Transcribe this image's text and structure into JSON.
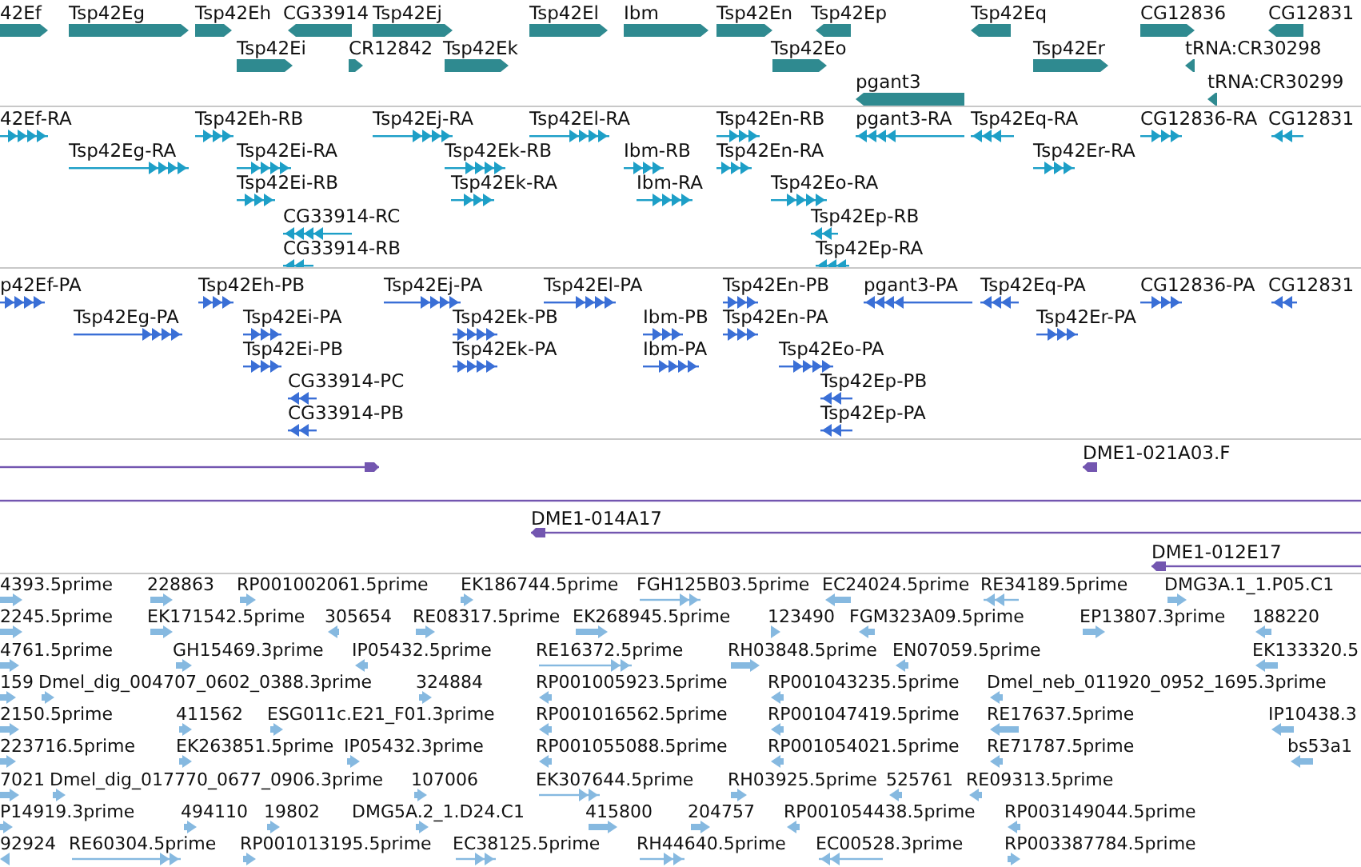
{
  "tracks": [
    {
      "kind": "gene",
      "features": [
        {
          "label": "42Ef",
          "reverse": false
        },
        {
          "label": "Tsp42Eg",
          "reverse": false
        },
        {
          "label": "Tsp42Eh",
          "reverse": false
        },
        {
          "label": "CG33914",
          "reverse": true
        },
        {
          "label": "Tsp42Ej",
          "reverse": false
        },
        {
          "label": "Tsp42El",
          "reverse": false
        },
        {
          "label": "Ibm",
          "reverse": false
        },
        {
          "label": "Tsp42En",
          "reverse": false
        },
        {
          "label": "Tsp42Ep",
          "reverse": true
        },
        {
          "label": "Tsp42Eq",
          "reverse": true
        },
        {
          "label": "CG12836",
          "reverse": false
        },
        {
          "label": "CG12831",
          "reverse": true
        },
        {
          "label": "Tsp42Ei",
          "reverse": false
        },
        {
          "label": "CR12842",
          "reverse": false
        },
        {
          "label": "Tsp42Ek",
          "reverse": false
        },
        {
          "label": "Tsp42Eo",
          "reverse": false
        },
        {
          "label": "Tsp42Er",
          "reverse": false
        },
        {
          "label": "tRNA:CR30298",
          "reverse": true
        },
        {
          "label": "pgant3",
          "reverse": true
        },
        {
          "label": "tRNA:CR30299",
          "reverse": true
        }
      ]
    },
    {
      "kind": "transcript",
      "features": [
        {
          "label": "42Ef-RA",
          "reverse": false
        },
        {
          "label": "Tsp42Eh-RB",
          "reverse": false
        },
        {
          "label": "Tsp42Ej-RA",
          "reverse": false
        },
        {
          "label": "Tsp42El-RA",
          "reverse": false
        },
        {
          "label": "Tsp42En-RB",
          "reverse": false
        },
        {
          "label": "pgant3-RA",
          "reverse": true
        },
        {
          "label": "Tsp42Eq-RA",
          "reverse": true
        },
        {
          "label": "CG12836-RA",
          "reverse": false
        },
        {
          "label": "CG12831",
          "reverse": true
        },
        {
          "label": "Tsp42Eg-RA",
          "reverse": false
        },
        {
          "label": "Tsp42Ei-RA",
          "reverse": false
        },
        {
          "label": "Tsp42Ek-RB",
          "reverse": false
        },
        {
          "label": "Ibm-RB",
          "reverse": false
        },
        {
          "label": "Tsp42En-RA",
          "reverse": false
        },
        {
          "label": "Tsp42Er-RA",
          "reverse": false
        },
        {
          "label": "Tsp42Ei-RB",
          "reverse": false
        },
        {
          "label": "Tsp42Ek-RA",
          "reverse": false
        },
        {
          "label": "Ibm-RA",
          "reverse": false
        },
        {
          "label": "Tsp42Eo-RA",
          "reverse": false
        },
        {
          "label": "CG33914-RC",
          "reverse": true
        },
        {
          "label": "Tsp42Ep-RB",
          "reverse": true
        },
        {
          "label": "CG33914-RB",
          "reverse": true
        },
        {
          "label": "Tsp42Ep-RA",
          "reverse": true
        }
      ]
    },
    {
      "kind": "protein",
      "features": [
        {
          "label": "p42Ef-PA",
          "reverse": false
        },
        {
          "label": "Tsp42Eh-PB",
          "reverse": false
        },
        {
          "label": "Tsp42Ej-PA",
          "reverse": false
        },
        {
          "label": "Tsp42El-PA",
          "reverse": false
        },
        {
          "label": "Tsp42En-PB",
          "reverse": false
        },
        {
          "label": "pgant3-PA",
          "reverse": true
        },
        {
          "label": "Tsp42Eq-PA",
          "reverse": true
        },
        {
          "label": "CG12836-PA",
          "reverse": false
        },
        {
          "label": "CG12831",
          "reverse": true
        },
        {
          "label": "Tsp42Eg-PA",
          "reverse": false
        },
        {
          "label": "Tsp42Ei-PA",
          "reverse": false
        },
        {
          "label": "Tsp42Ek-PB",
          "reverse": false
        },
        {
          "label": "Ibm-PB",
          "reverse": false
        },
        {
          "label": "Tsp42En-PA",
          "reverse": false
        },
        {
          "label": "Tsp42Er-PA",
          "reverse": false
        },
        {
          "label": "Tsp42Ei-PB",
          "reverse": false
        },
        {
          "label": "Tsp42Ek-PA",
          "reverse": false
        },
        {
          "label": "Ibm-PA",
          "reverse": false
        },
        {
          "label": "Tsp42Eo-PA",
          "reverse": false
        },
        {
          "label": "CG33914-PC",
          "reverse": true
        },
        {
          "label": "Tsp42Ep-PB",
          "reverse": true
        },
        {
          "label": "CG33914-PB",
          "reverse": true
        },
        {
          "label": "Tsp42Ep-PA",
          "reverse": true
        }
      ]
    },
    {
      "kind": "clone",
      "features": [
        {
          "kind": "arrow",
          "reverse": false
        },
        {
          "kind": "arrow",
          "label": "DME1-021A03.F",
          "reverse": true
        },
        {
          "kind": "span"
        },
        {
          "kind": "arrow",
          "label": "DME1-014A17",
          "reverse": true
        },
        {
          "kind": "arrow",
          "label": "DME1-012E17",
          "reverse": true
        }
      ]
    },
    {
      "kind": "est",
      "features": [
        {
          "label": "4393.5prime",
          "reverse": false
        },
        {
          "label": "228863",
          "reverse": false
        },
        {
          "label": "RP001002061.5prime",
          "reverse": false
        },
        {
          "label": "EK186744.5prime",
          "reverse": false
        },
        {
          "label": "FGH125B03.5prime",
          "reverse": false
        },
        {
          "label": "EC24024.5prime",
          "reverse": true
        },
        {
          "label": "RE34189.5prime",
          "reverse": true
        },
        {
          "label": "DMG3A.1_1.P05.C1",
          "reverse": false
        },
        {
          "label": "2245.5prime",
          "reverse": false
        },
        {
          "label": "EK171542.5prime",
          "reverse": false
        },
        {
          "label": "305654",
          "reverse": true
        },
        {
          "label": "RE08317.5prime",
          "reverse": false
        },
        {
          "label": "EK268945.5prime",
          "reverse": false
        },
        {
          "label": "123490",
          "reverse": false
        },
        {
          "label": "FGM323A09.5prime",
          "reverse": true
        },
        {
          "label": "EP13807.3prime",
          "reverse": false
        },
        {
          "label": "188220",
          "reverse": true
        },
        {
          "label": "4761.5prime",
          "reverse": false
        },
        {
          "label": "GH15469.3prime",
          "reverse": false
        },
        {
          "label": "IP05432.5prime",
          "reverse": true
        },
        {
          "label": "RE16372.5prime",
          "reverse": false
        },
        {
          "label": "RH03848.5prime",
          "reverse": false
        },
        {
          "label": "EN07059.5prime",
          "reverse": true
        },
        {
          "label": "EK133320.5",
          "reverse": true
        },
        {
          "label": "159",
          "reverse": false
        },
        {
          "label": "Dmel_dig_004707_0602_0388.3prime",
          "reverse": false
        },
        {
          "label": "324884",
          "reverse": false
        },
        {
          "label": "RP001005923.5prime",
          "reverse": true
        },
        {
          "label": "RP001043235.5prime",
          "reverse": true
        },
        {
          "label": "Dmel_neb_011920_0952_1695.3prime",
          "reverse": true
        },
        {
          "label": "2150.5prime",
          "reverse": false
        },
        {
          "label": "411562",
          "reverse": false
        },
        {
          "label": "ESG011c.E21_F01.3prime",
          "reverse": false
        },
        {
          "label": "RP001016562.5prime",
          "reverse": true
        },
        {
          "label": "RP001047419.5prime",
          "reverse": true
        },
        {
          "label": "RE17637.5prime",
          "reverse": true
        },
        {
          "label": "IP10438.3",
          "reverse": true
        },
        {
          "label": "223716.5prime",
          "reverse": false
        },
        {
          "label": "EK263851.5prime",
          "reverse": false
        },
        {
          "label": "IP05432.3prime",
          "reverse": false
        },
        {
          "label": "RP001055088.5prime",
          "reverse": true
        },
        {
          "label": "RP001054021.5prime",
          "reverse": true
        },
        {
          "label": "RE71787.5prime",
          "reverse": true
        },
        {
          "label": "bs53a1",
          "reverse": true
        },
        {
          "label": "7021",
          "reverse": false
        },
        {
          "label": "Dmel_dig_017770_0677_0906.3prime",
          "reverse": false
        },
        {
          "label": "107006",
          "reverse": false
        },
        {
          "label": "EK307644.5prime",
          "reverse": false
        },
        {
          "label": "RH03925.5prime",
          "reverse": false
        },
        {
          "label": "525761",
          "reverse": true
        },
        {
          "label": "RE09313.5prime",
          "reverse": true
        },
        {
          "label": "P14919.3prime",
          "reverse": false
        },
        {
          "label": "494110",
          "reverse": false
        },
        {
          "label": "19802",
          "reverse": false
        },
        {
          "label": "DMG5A.2_1.D24.C1",
          "reverse": false
        },
        {
          "label": "415800",
          "reverse": false
        },
        {
          "label": "204757",
          "reverse": false
        },
        {
          "label": "RP001054438.5prime",
          "reverse": true
        },
        {
          "label": "RP003149044.5prime",
          "reverse": true
        },
        {
          "label": "92924",
          "reverse": true
        },
        {
          "label": "RE60304.5prime",
          "reverse": false
        },
        {
          "label": "RP001013195.5prime",
          "reverse": false
        },
        {
          "label": "EC38125.5prime",
          "reverse": false
        },
        {
          "label": "RH44640.5prime",
          "reverse": false
        },
        {
          "label": "EC00528.3prime",
          "reverse": true
        },
        {
          "label": "RP003387784.5prime",
          "reverse": false
        }
      ]
    }
  ]
}
